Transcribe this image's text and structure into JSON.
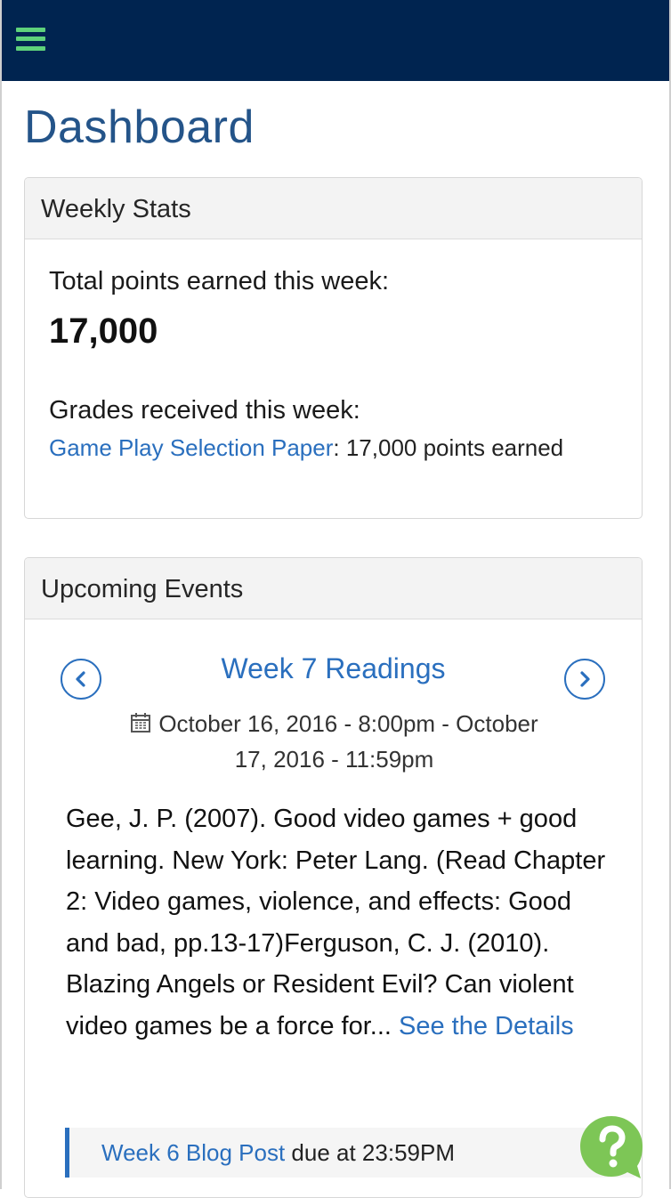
{
  "header": {
    "menu_icon": "hamburger-menu-icon",
    "brand_color": "#002450",
    "menu_icon_color": "#5ed27b"
  },
  "page": {
    "title": "Dashboard"
  },
  "weekly_stats": {
    "heading": "Weekly Stats",
    "points_label": "Total points earned this week:",
    "points_value": "17,000",
    "grades_label": "Grades received this week:",
    "grades": [
      {
        "name": "Game Play Selection Paper",
        "detail": ": 17,000 points earned"
      }
    ]
  },
  "upcoming_events": {
    "heading": "Upcoming Events",
    "prev_icon": "chevron-left-icon",
    "next_icon": "chevron-right-icon",
    "event": {
      "title": "Week 7 Readings",
      "time_icon": "calendar-icon",
      "time": "October 16, 2016 - 8:00pm - October 17, 2016 - 11:59pm",
      "description": "Gee, J. P. (2007). Good video games + good learning. New York: Peter Lang. (Read Chapter 2: Video games, violence, and effects: Good and bad, pp.13-17)Ferguson, C. J. (2010). Blazing Angels or Resident Evil? Can violent video games be a force for...",
      "details_link": "See the Details"
    },
    "due": [
      {
        "name": "Week 6 Blog Post",
        "suffix": " due at 23:59PM"
      }
    ]
  },
  "help": {
    "icon": "help-question-icon",
    "color": "#7dc656"
  },
  "colors": {
    "link": "#2a6fbe",
    "title": "#245489"
  }
}
